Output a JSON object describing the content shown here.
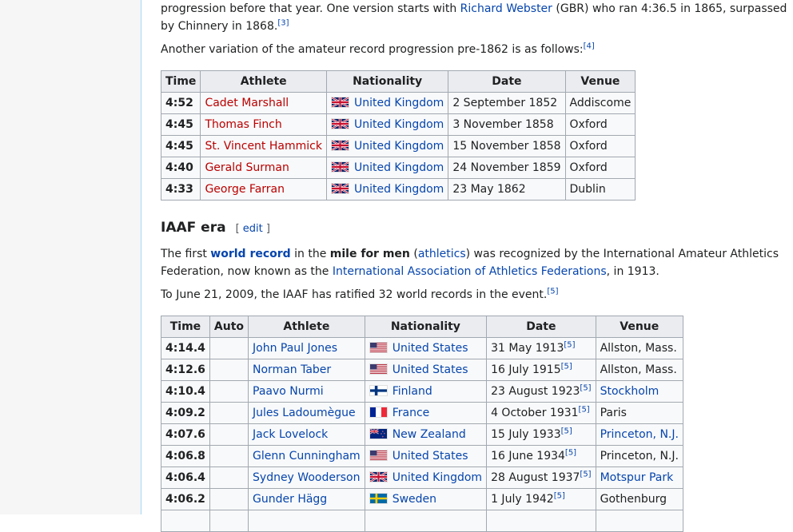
{
  "intro": {
    "para1_part1": "progression before that year. One version starts with ",
    "para1_link": "Richard Webster",
    "para1_part2": " (GBR) who ran 4:36.5 in 1865, surpassed",
    "para1_line2": "by Chinnery in 1868.",
    "para1_ref": "[3]",
    "para2": "Another variation of the amateur record progression pre-1862 is as follows:",
    "para2_ref": "[4]"
  },
  "table1": {
    "headers": [
      "Time",
      "Athlete",
      "Nationality",
      "Date",
      "Venue"
    ],
    "rows": [
      {
        "time": "4:52",
        "athlete": "Cadet Marshall",
        "flag": "uk-flag",
        "nationality": "United Kingdom",
        "date": "2 September 1852",
        "venue": "Addiscome"
      },
      {
        "time": "4:45",
        "athlete": "Thomas Finch",
        "flag": "uk-flag",
        "nationality": "United Kingdom",
        "date": "3 November 1858",
        "venue": "Oxford"
      },
      {
        "time": "4:45",
        "athlete": "St. Vincent Hammick",
        "flag": "uk-flag",
        "nationality": "United Kingdom",
        "date": "15 November 1858",
        "venue": "Oxford"
      },
      {
        "time": "4:40",
        "athlete": "Gerald Surman",
        "flag": "uk-flag",
        "nationality": "United Kingdom",
        "date": "24 November 1859",
        "venue": "Oxford"
      },
      {
        "time": "4:33",
        "athlete": "George Farran",
        "flag": "uk-flag",
        "nationality": "United Kingdom",
        "date": "23 May 1862",
        "venue": "Dublin"
      }
    ]
  },
  "section": {
    "heading": "IAAF era",
    "edit_open": "[ ",
    "edit_label": "edit",
    "edit_close": " ]",
    "p1_a": "The first ",
    "p1_link1": "world record",
    "p1_b": " in the ",
    "p1_bold": "mile for men",
    "p1_c": " (",
    "p1_link2": "athletics",
    "p1_d": ") was recognized by the International Amateur Athletics Federation, now known as the ",
    "p1_link3": "International Association of Athletics Federations",
    "p1_e": ", in 1913.",
    "p2": "To June 21, 2009, the IAAF has ratified 32 world records in the event.",
    "p2_ref": "[5]"
  },
  "table2": {
    "headers": [
      "Time",
      "Auto",
      "Athlete",
      "Nationality",
      "Date",
      "Venue"
    ],
    "ref": "[5]",
    "rows": [
      {
        "time": "4:14.4",
        "auto": "",
        "athlete": "John Paul Jones",
        "flag": "us-flag",
        "nationality": "United States",
        "date": "31 May 1913",
        "venue": "Allston, Mass.",
        "venue_link": false
      },
      {
        "time": "4:12.6",
        "auto": "",
        "athlete": "Norman Taber",
        "flag": "us-flag",
        "nationality": "United States",
        "date": "16 July 1915",
        "venue": "Allston, Mass.",
        "venue_link": false
      },
      {
        "time": "4:10.4",
        "auto": "",
        "athlete": "Paavo Nurmi",
        "flag": "finland-flag",
        "nationality": "Finland",
        "date": "23 August 1923",
        "venue": "Stockholm",
        "venue_link": true
      },
      {
        "time": "4:09.2",
        "auto": "",
        "athlete": "Jules Ladoumègue",
        "flag": "france-flag",
        "nationality": "France",
        "date": "4 October 1931",
        "venue": "Paris",
        "venue_link": false
      },
      {
        "time": "4:07.6",
        "auto": "",
        "athlete": "Jack Lovelock",
        "flag": "new-zealand-flag",
        "nationality": "New Zealand",
        "date": "15 July 1933",
        "venue": "Princeton, N.J.",
        "venue_link": true
      },
      {
        "time": "4:06.8",
        "auto": "",
        "athlete": "Glenn Cunningham",
        "flag": "us-flag",
        "nationality": "United States",
        "date": "16 June 1934",
        "venue": "Princeton, N.J.",
        "venue_link": false
      },
      {
        "time": "4:06.4",
        "auto": "",
        "athlete": "Sydney Wooderson",
        "flag": "uk-flag",
        "nationality": "United Kingdom",
        "date": "28 August 1937",
        "venue": "Motspur Park",
        "venue_link": true
      },
      {
        "time": "4:06.2",
        "auto": "",
        "athlete": "Gunder Hägg",
        "flag": "sweden-flag",
        "nationality": "Sweden",
        "date": "1 July 1942",
        "venue": "Gothenburg",
        "venue_link": false
      },
      {
        "time": "",
        "auto": "",
        "athlete": "",
        "flag": "",
        "nationality": "",
        "date": "",
        "venue": "",
        "venue_link": false
      }
    ]
  },
  "colors": {
    "link": "#0645ad",
    "redlink": "#ba0000",
    "table_bg": "#f8f9fa",
    "header_bg": "#eaecf0",
    "border": "#a2a9b1",
    "sidebar_bg": "#f6f6f6"
  }
}
